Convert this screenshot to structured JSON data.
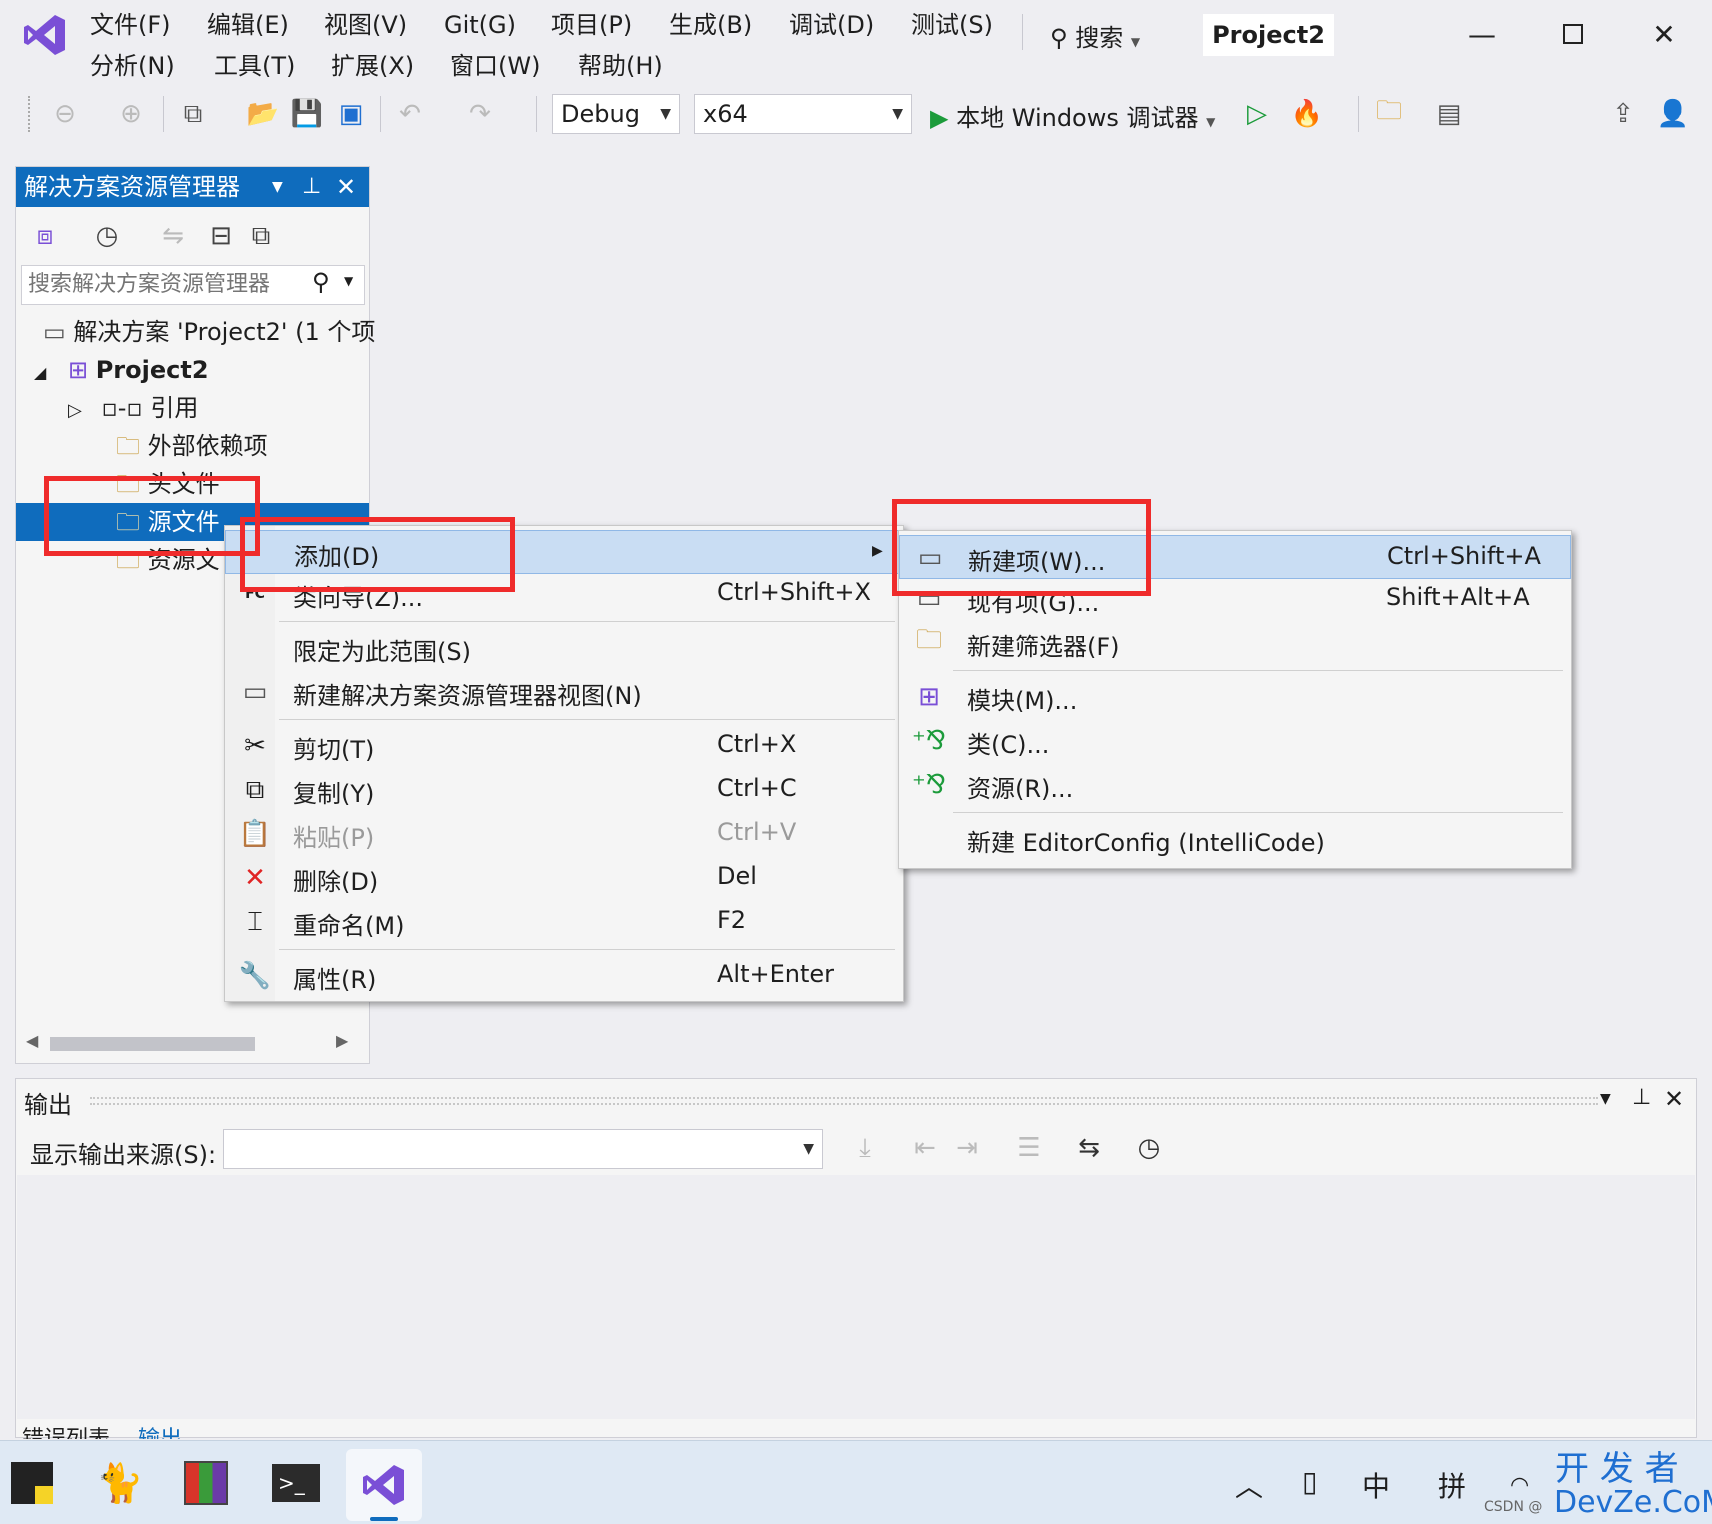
{
  "menubar": {
    "row1": [
      "文件(F)",
      "编辑(E)",
      "视图(V)",
      "Git(G)",
      "项目(P)",
      "生成(B)",
      "调试(D)",
      "测试(S)"
    ],
    "row2": [
      "分析(N)",
      "工具(T)",
      "扩展(X)",
      "窗口(W)",
      "帮助(H)"
    ],
    "search_label": "搜索",
    "project_title": "Project2"
  },
  "toolbar": {
    "config": "Debug",
    "platform": "x64",
    "debugger_label": "本地 Windows 调试器"
  },
  "solution_explorer": {
    "title": "解决方案资源管理器",
    "search_placeholder": "搜索解决方案资源管理器",
    "tree": {
      "solution": "解决方案 'Project2' (1 个项",
      "project": "Project2",
      "references": "引用",
      "external_deps": "外部依赖项",
      "header_files": "头文件",
      "source_files": "源文件",
      "resource_files": "资源文"
    }
  },
  "context_menu": {
    "items": [
      {
        "label": "添加(D)",
        "shortcut": "",
        "icon": "add-submenu"
      },
      {
        "label": "类向导(Z)...",
        "shortcut": "Ctrl+Shift+X",
        "icon": "class-wizard-icon"
      },
      {
        "label": "限定为此范围(S)",
        "shortcut": "",
        "icon": ""
      },
      {
        "label": "新建解决方案资源管理器视图(N)",
        "shortcut": "",
        "icon": "new-view-icon"
      },
      {
        "label": "剪切(T)",
        "shortcut": "Ctrl+X",
        "icon": "scissors-icon"
      },
      {
        "label": "复制(Y)",
        "shortcut": "Ctrl+C",
        "icon": "copy-icon"
      },
      {
        "label": "粘贴(P)",
        "shortcut": "Ctrl+V",
        "icon": "paste-icon"
      },
      {
        "label": "删除(D)",
        "shortcut": "Del",
        "icon": "delete-icon"
      },
      {
        "label": "重命名(M)",
        "shortcut": "F2",
        "icon": "rename-icon"
      },
      {
        "label": "属性(R)",
        "shortcut": "Alt+Enter",
        "icon": "wrench-icon"
      }
    ]
  },
  "submenu": {
    "items": [
      {
        "label": "新建项(W)...",
        "shortcut": "Ctrl+Shift+A"
      },
      {
        "label": "现有项(G)...",
        "shortcut": "Shift+Alt+A"
      },
      {
        "label": "新建筛选器(F)",
        "shortcut": ""
      },
      {
        "label": "模块(M)...",
        "shortcut": ""
      },
      {
        "label": "类(C)...",
        "shortcut": ""
      },
      {
        "label": "资源(R)...",
        "shortcut": ""
      },
      {
        "label": "新建 EditorConfig (IntelliCode)",
        "shortcut": ""
      }
    ]
  },
  "output": {
    "title": "输出",
    "source_label": "显示输出来源(S):",
    "bottom_tabs": [
      "错误列表",
      "输出"
    ]
  },
  "taskbar": {
    "ime_mode": "中",
    "ime_type": "拼",
    "watermark_top": "开 发 者",
    "watermark_prefix": "CSDN @",
    "watermark_bottom": "DevZe.CoM"
  },
  "colors": {
    "accent": "#0f6cbd",
    "highlight": "#c9ddf3",
    "red_box": "#ef2b2b",
    "green_play": "#1c9b3b",
    "vs_purple": "#7a4fd6"
  }
}
